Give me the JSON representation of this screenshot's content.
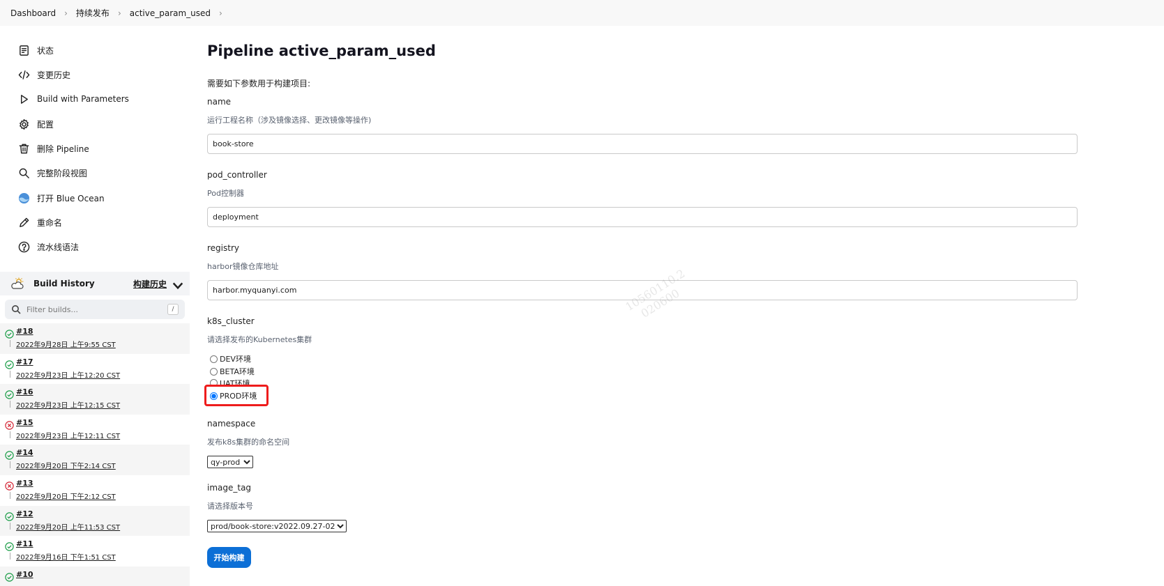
{
  "breadcrumb": [
    "Dashboard",
    "持续发布",
    "active_param_used"
  ],
  "sidebar": {
    "tasks": [
      {
        "label": "状态",
        "icon": "status-document-icon"
      },
      {
        "label": "变更历史",
        "icon": "code-icon"
      },
      {
        "label": "Build with Parameters",
        "icon": "play-icon"
      },
      {
        "label": "配置",
        "icon": "gear-icon"
      },
      {
        "label": "删除 Pipeline",
        "icon": "trash-icon"
      },
      {
        "label": "完整阶段视图",
        "icon": "search-icon"
      },
      {
        "label": "打开 Blue Ocean",
        "icon": "blue-ocean-icon"
      },
      {
        "label": "重命名",
        "icon": "pencil-icon"
      },
      {
        "label": "流水线语法",
        "icon": "help-circle-icon"
      }
    ]
  },
  "build_history": {
    "title": "Build History",
    "trend_label": "构建历史",
    "filter_placeholder": "Filter builds...",
    "filter_shortcut": "/",
    "builds": [
      {
        "number": "#18",
        "date": "2022年9月28日 上午9:55 CST",
        "status": "success"
      },
      {
        "number": "#17",
        "date": "2022年9月23日 上午12:20 CST",
        "status": "success"
      },
      {
        "number": "#16",
        "date": "2022年9月23日 上午12:15 CST",
        "status": "success"
      },
      {
        "number": "#15",
        "date": "2022年9月23日 上午12:11 CST",
        "status": "failed"
      },
      {
        "number": "#14",
        "date": "2022年9月20日 下午2:14 CST",
        "status": "success"
      },
      {
        "number": "#13",
        "date": "2022年9月20日 下午2:12 CST",
        "status": "failed"
      },
      {
        "number": "#12",
        "date": "2022年9月20日 上午11:53 CST",
        "status": "success"
      },
      {
        "number": "#11",
        "date": "2022年9月16日 下午1:51 CST",
        "status": "success"
      },
      {
        "number": "#10",
        "date": "",
        "status": "success"
      }
    ]
  },
  "main": {
    "title": "Pipeline active_param_used",
    "intro": "需要如下参数用于构建项目:",
    "params": {
      "name": {
        "name": "name",
        "desc": "运行工程名称（涉及镜像选择、更改镜像等操作)",
        "value": "book-store"
      },
      "pod_controller": {
        "name": "pod_controller",
        "desc": "Pod控制器",
        "value": "deployment"
      },
      "registry": {
        "name": "registry",
        "desc": "harbor镜像仓库地址",
        "value": "harbor.myquanyi.com"
      },
      "k8s_cluster": {
        "name": "k8s_cluster",
        "desc": "请选择发布的Kubernetes集群",
        "options": [
          "DEV环境",
          "BETA环境",
          "UAT环境",
          "PROD环境"
        ],
        "selected": "PROD环境"
      },
      "namespace": {
        "name": "namespace",
        "desc": "发布k8s集群的命名空间",
        "selected": "qy-prod"
      },
      "image_tag": {
        "name": "image_tag",
        "desc": "请选择版本号",
        "selected": "prod/book-store:v2022.09.27-02"
      }
    },
    "build_button": "开始构建",
    "watermark": [
      "10560110.2",
      "020600"
    ]
  },
  "colors": {
    "accent": "#0c6fd6",
    "success": "#1e9e4a",
    "failed": "#d52b3a",
    "highlight": "#ee1c1c"
  }
}
